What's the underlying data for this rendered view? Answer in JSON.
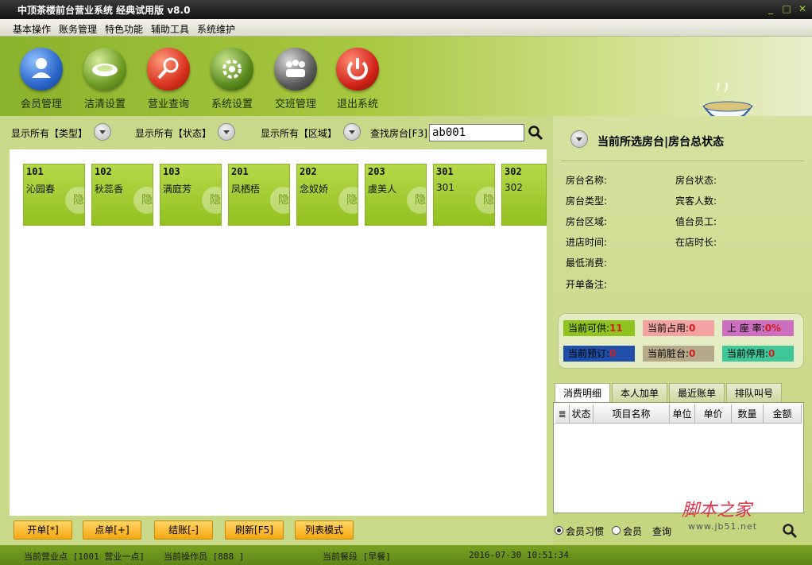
{
  "window": {
    "title": "中顶茶楼前台营业系统 经典试用版 v8.0",
    "min": "_",
    "max": "□",
    "close": "✕"
  },
  "menu": [
    "基本操作",
    "账务管理",
    "特色功能",
    "辅助工具",
    "系统维护"
  ],
  "toolbar": [
    {
      "label": "会员管理",
      "icon": "person-icon",
      "color": "#2a66c8"
    },
    {
      "label": "洁清设置",
      "icon": "plate-icon",
      "color": "#6c9b22"
    },
    {
      "label": "营业查询",
      "icon": "magnifier-icon",
      "color": "#d8321e"
    },
    {
      "label": "系统设置",
      "icon": "gear-icon",
      "color": "#5a8a1e"
    },
    {
      "label": "交班管理",
      "icon": "team-icon",
      "color": "#5a5a5a"
    },
    {
      "label": "退出系统",
      "icon": "power-icon",
      "color": "#d1241a"
    }
  ],
  "filters": {
    "type": "显示所有【类型】",
    "status": "显示所有【状态】",
    "area": "显示所有【区域】",
    "search_label": "查找房台[F3]",
    "search_value": "ab001"
  },
  "rooms": [
    {
      "no": "101",
      "name": "沁园春"
    },
    {
      "no": "102",
      "name": "秋蕊香"
    },
    {
      "no": "103",
      "name": "满庭芳"
    },
    {
      "no": "201",
      "name": "凤栖梧"
    },
    {
      "no": "202",
      "name": "念奴娇"
    },
    {
      "no": "203",
      "name": "虞美人"
    },
    {
      "no": "301",
      "name": "301"
    },
    {
      "no": "302",
      "name": "302"
    }
  ],
  "room_logo": "隐",
  "actions": [
    "开单[*]",
    "点单[+]",
    "结账[-]",
    "刷新[F5]",
    "列表模式"
  ],
  "right": {
    "title": "当前所选房台|房台总状态",
    "fields_left": [
      "房台名称:",
      "房台类型:",
      "房台区域:",
      "进店时间:",
      "最低消费:",
      "开单备注:"
    ],
    "fields_right": [
      "房台状态:",
      "宾客人数:",
      "值台员工:",
      "在店时长:"
    ],
    "stats": [
      {
        "label": "当前可供:",
        "value": "11",
        "bg": "#8fc31f"
      },
      {
        "label": "当前占用:",
        "value": "0",
        "bg": "#f4a3a3"
      },
      {
        "label": "上 座 率:",
        "value": "0%",
        "bg": "#cc6fc0"
      },
      {
        "label": "当前预订:",
        "value": "0",
        "bg": "#1f4fa8"
      },
      {
        "label": "当前脏台:",
        "value": "0",
        "bg": "#b6a98a"
      },
      {
        "label": "当前停用:",
        "value": "0",
        "bg": "#3fc79a"
      }
    ],
    "tabs": [
      "消费明细",
      "本人加单",
      "最近账单",
      "排队叫号"
    ],
    "columns": [
      "状态",
      "项目名称",
      "单位",
      "单价",
      "数量",
      "金额"
    ],
    "options": [
      "会员习惯",
      "会员",
      "查询"
    ]
  },
  "status": {
    "point": "当前营业点 [1001 营业一点]",
    "operator": "当前操作员 [888 ]",
    "period": "当前餐段 [早餐]",
    "datetime": "2016-07-30 10:51:34"
  },
  "watermark": {
    "cn": "脚本之家",
    "url": "www.jb51.net"
  }
}
